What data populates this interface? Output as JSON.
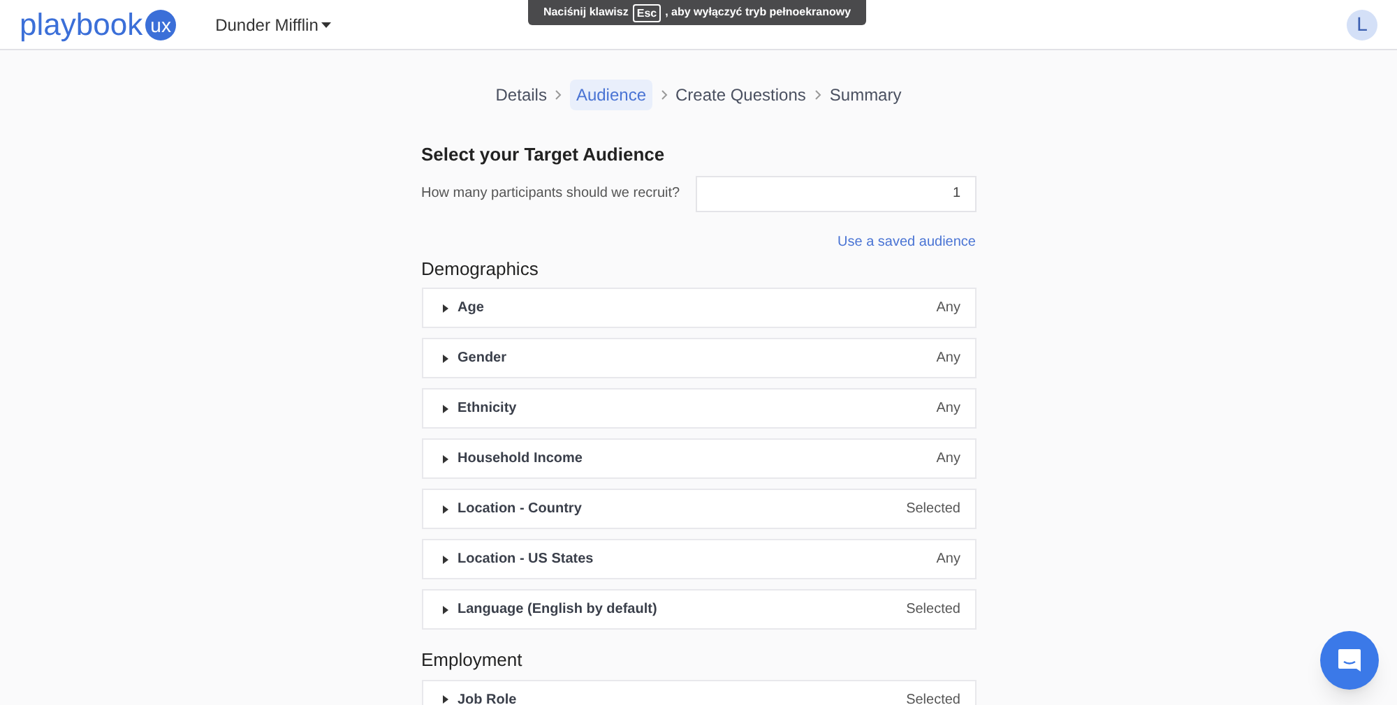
{
  "header": {
    "logo_text": "playbook",
    "logo_badge": "ux",
    "workspace": "Dunder Mifflin",
    "avatar": "L"
  },
  "fullscreen_toast": {
    "before": "Naciśnij klawisz",
    "key": "Esc",
    "after": ", aby wyłączyć tryb pełnoekranowy"
  },
  "steps": [
    {
      "label": "Details",
      "selected": false
    },
    {
      "label": "Audience",
      "selected": true
    },
    {
      "label": "Create Questions",
      "selected": false
    },
    {
      "label": "Summary",
      "selected": false
    }
  ],
  "title": "Select your Target Audience",
  "participants": {
    "label": "How many participants should we recruit?",
    "value": "1"
  },
  "saved_audience_link": "Use a saved audience",
  "sections": [
    {
      "title": "Demographics",
      "items": [
        {
          "label": "Age",
          "value": "Any",
          "expanded": false
        },
        {
          "label": "Gender",
          "value": "Any",
          "expanded": false
        },
        {
          "label": "Ethnicity",
          "value": "Any",
          "expanded": false
        },
        {
          "label": "Household Income",
          "value": "Any",
          "expanded": false
        },
        {
          "label": "Location - Country",
          "value": "Selected",
          "expanded": false
        },
        {
          "label": "Location - US States",
          "value": "Any",
          "expanded": false
        },
        {
          "label": "Language (English by default)",
          "value": "Selected",
          "expanded": false
        }
      ]
    },
    {
      "title": "Employment",
      "items": [
        {
          "label": "Job Role",
          "value": "Selected",
          "expanded": false
        }
      ]
    }
  ]
}
